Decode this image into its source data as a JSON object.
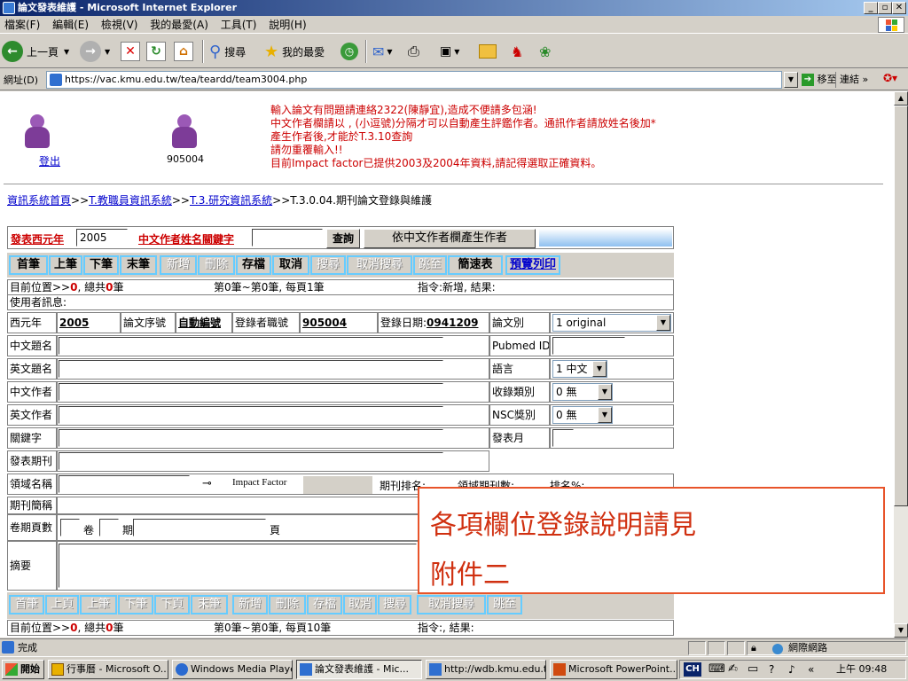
{
  "window": {
    "title": "論文發表維護 - Microsoft Internet Explorer"
  },
  "menu": [
    "檔案(F)",
    "編輯(E)",
    "檢視(V)",
    "我的最愛(A)",
    "工具(T)",
    "說明(H)"
  ],
  "toolbar": {
    "back": "上一頁",
    "search": "搜尋",
    "favorites": "我的最愛"
  },
  "address": {
    "label": "網址(D)",
    "url": "https://vac.kmu.edu.tw/tea/teardd/team3004.php",
    "go": "移至",
    "links": "連結"
  },
  "page": {
    "logout": "登出",
    "user_id": "905004",
    "notice": [
      "輸入論文有問題請連絡2322(陳靜宜),造成不便請多包涵!",
      "中文作者欄請以 , (小逗號)分隔才可以自動產生評鑑作者。通訊作者請放姓名後加*",
      "產生作者後,才能於T.3.10查詢",
      "請勿重覆輸入!!",
      "目前Impact factor已提供2003及2004年資料,請記得選取正確資料。"
    ],
    "breadcrumb": {
      "home": "資訊系統首頁",
      "sep": ">>",
      "b2": "T.教職員資訊系統",
      "b3": "T.3.研究資訊系統",
      "current": "T.3.0.04.期刊論文登錄與維護"
    },
    "search": {
      "year_label": "發表西元年",
      "year_value": "2005",
      "name_label": "中文作者姓名關鍵字",
      "query_btn": "查詢",
      "gen_btn": "依中文作者欄產生作者"
    },
    "nav_buttons": [
      "首筆",
      "上筆",
      "下筆",
      "末筆",
      "新增",
      "刪除",
      "存檔",
      "取消",
      "搜尋",
      "取消搜尋",
      "跳至",
      "簡速表",
      "預覽列印"
    ],
    "position": {
      "label": "目前位置>>",
      "current": "0",
      "total_label": ", 總共",
      "total": "0",
      "unit": "筆",
      "range": "第0筆~第0筆, 每頁1筆",
      "cmd": "指令:新增, 結果:"
    },
    "user_msg": "使用者訊息:",
    "fields": {
      "year_label": "西元年",
      "year": "2005",
      "serial_label": "論文序號",
      "serial": "自動編號",
      "recorder_label": "登錄者職號",
      "recorder": "905004",
      "date_label": "登錄日期:",
      "date": "0941209",
      "type_label": "論文別",
      "type_value": "1 original",
      "cn_title": "中文題名",
      "pubmed": "Pubmed ID",
      "en_title": "英文題名",
      "lang": "語言",
      "lang_value": "1 中文",
      "cn_author": "中文作者",
      "collect": "收錄類別",
      "collect_value": "0 無",
      "en_author": "英文作者",
      "nsc": "NSC獎別",
      "nsc_value": "0 無",
      "keyword": "關鍵字",
      "month": "發表月",
      "journal": "發表期刊",
      "field_name": "領域名稱",
      "impact": "Impact Factor",
      "journal_rank": "期刊排名:",
      "field_count": "領域期刊數:",
      "rank_pct": "排名%:",
      "abbr": "期刊簡稱",
      "volume": "卷期頁數",
      "vol_unit": "卷",
      "issue_unit": "期",
      "page_unit": "頁",
      "abstract": "摘要"
    },
    "bottom_nav": [
      "首筆",
      "上頁",
      "上筆",
      "下筆",
      "下頁",
      "末筆",
      "新增",
      "刪除",
      "存檔",
      "取消",
      "搜尋",
      "取消搜尋",
      "跳至"
    ],
    "bottom_position": {
      "label": "目前位置>>",
      "current": "0",
      "total_label": ", 總共",
      "total": "0",
      "unit": "筆",
      "range": "第0筆~第0筆, 每頁10筆",
      "cmd": "指令:, 結果:"
    },
    "overlay": {
      "line1": "各項欄位登錄說明請見",
      "line2": "附件二"
    }
  },
  "status": {
    "text": "完成",
    "zone": "網際網路"
  },
  "taskbar": {
    "start": "開始",
    "items": [
      "行事曆 - Microsoft O...",
      "Windows Media Player",
      "論文發表維護 - Mic...",
      "http://wdb.kmu.edu.t...",
      "Microsoft PowerPoint..."
    ],
    "ime": "CH",
    "clock": "上午 09:48"
  },
  "colors": {
    "accent": "#0a246a",
    "red": "#cc0000",
    "link": "#0000cc",
    "overlay_border": "#e8542a"
  }
}
